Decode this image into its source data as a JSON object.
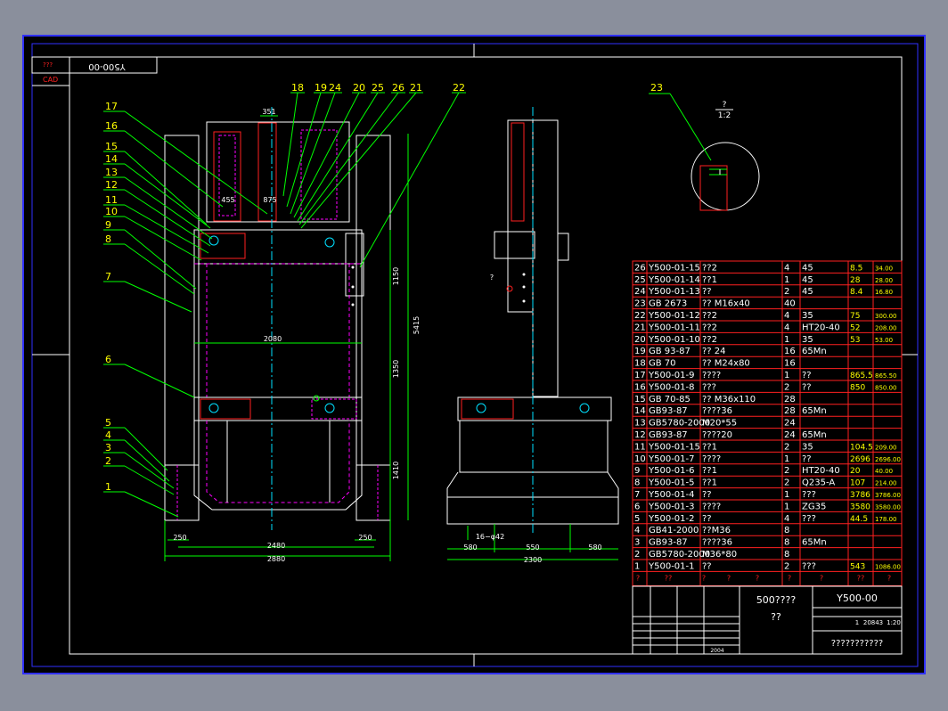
{
  "title_corner": {
    "top": "???",
    "cad": "CAD",
    "drawing_no": "Y500-00"
  },
  "balloons": {
    "left_stack": [
      "17",
      "16",
      "15",
      "14",
      "13",
      "12",
      "11",
      "10",
      "9",
      "8",
      "7",
      "6",
      "5",
      "4",
      "3",
      "2",
      "1"
    ],
    "top_row": [
      "18",
      "19",
      "24",
      "20",
      "25",
      "26",
      "21",
      "22"
    ],
    "detail": "23"
  },
  "dims": {
    "top_width": "351",
    "d455": "455",
    "d875": "875",
    "d2080": "2080",
    "d1150": "1150",
    "d1350": "1350",
    "d1410": "1410",
    "d5415": "5415",
    "d250_left": "250",
    "d250_right": "250",
    "d2480": "2480",
    "d2880": "2880",
    "holes": "16−φ42",
    "d580a": "580",
    "d550": "550",
    "d580b": "580",
    "d2300": "2300",
    "side_q": "?"
  },
  "detail_label": {
    "num": "?",
    "scale": "1:2"
  },
  "bom": [
    {
      "no": "26",
      "code": "Y500-01-15",
      "name": "??2",
      "qty": "4",
      "mat": "45",
      "w1": "8.5",
      "w2": "34.00"
    },
    {
      "no": "25",
      "code": "Y500-01-14",
      "name": "??1",
      "qty": "1",
      "mat": "45",
      "w1": "28",
      "w2": "28.00"
    },
    {
      "no": "24",
      "code": "Y500-01-13",
      "name": "??",
      "qty": "2",
      "mat": "45",
      "w1": "8.4",
      "w2": "16.80"
    },
    {
      "no": "23",
      "code": "GB 2673",
      "name": "??  M16x40",
      "qty": "40",
      "mat": "",
      "w1": "",
      "w2": ""
    },
    {
      "no": "22",
      "code": "Y500-01-12",
      "name": "??2",
      "qty": "4",
      "mat": "35",
      "w1": "75",
      "w2": "300.00"
    },
    {
      "no": "21",
      "code": "Y500-01-11",
      "name": "??2",
      "qty": "4",
      "mat": "HT20-40",
      "w1": "52",
      "w2": "208.00"
    },
    {
      "no": "20",
      "code": "Y500-01-10",
      "name": "??2",
      "qty": "1",
      "mat": "35",
      "w1": "53",
      "w2": "53.00"
    },
    {
      "no": "19",
      "code": "GB 93-87",
      "name": "?? 24",
      "qty": "16",
      "mat": "65Mn",
      "w1": "",
      "w2": ""
    },
    {
      "no": "18",
      "code": "GB 70",
      "name": "?? M24x80",
      "qty": "16",
      "mat": "",
      "w1": "",
      "w2": ""
    },
    {
      "no": "17",
      "code": "Y500-01-9",
      "name": "????",
      "qty": "1",
      "mat": "??",
      "w1": "865.5",
      "w2": "865.50"
    },
    {
      "no": "16",
      "code": "Y500-01-8",
      "name": "???",
      "qty": "2",
      "mat": "??",
      "w1": "850",
      "w2": "850.00"
    },
    {
      "no": "15",
      "code": "GB 70-85",
      "name": "?? M36x110",
      "qty": "28",
      "mat": "",
      "w1": "",
      "w2": ""
    },
    {
      "no": "14",
      "code": "GB93-87",
      "name": "????36",
      "qty": "28",
      "mat": "65Mn",
      "w1": "",
      "w2": ""
    },
    {
      "no": "13",
      "code": "GB5780-2000",
      "name": "M20*55",
      "qty": "24",
      "mat": "",
      "w1": "",
      "w2": ""
    },
    {
      "no": "12",
      "code": "GB93-87",
      "name": "????20",
      "qty": "24",
      "mat": "65Mn",
      "w1": "",
      "w2": ""
    },
    {
      "no": "11",
      "code": "Y500-01-15",
      "name": "??1",
      "qty": "2",
      "mat": "35",
      "w1": "104.5",
      "w2": "209.00"
    },
    {
      "no": "10",
      "code": "Y500-01-7",
      "name": "????",
      "qty": "1",
      "mat": "??",
      "w1": "2696",
      "w2": "2696.00"
    },
    {
      "no": "9",
      "code": "Y500-01-6",
      "name": "??1",
      "qty": "2",
      "mat": "HT20-40",
      "w1": "20",
      "w2": "40.00"
    },
    {
      "no": "8",
      "code": "Y500-01-5",
      "name": "??1",
      "qty": "2",
      "mat": "Q235-A",
      "w1": "107",
      "w2": "214.00"
    },
    {
      "no": "7",
      "code": "Y500-01-4",
      "name": "??",
      "qty": "1",
      "mat": "???",
      "w1": "3786",
      "w2": "3786.00"
    },
    {
      "no": "6",
      "code": "Y500-01-3",
      "name": "????",
      "qty": "1",
      "mat": "ZG35",
      "w1": "3580",
      "w2": "3580.00"
    },
    {
      "no": "5",
      "code": "Y500-01-2",
      "name": "??",
      "qty": "4",
      "mat": "???",
      "w1": "44.5",
      "w2": "178.00"
    },
    {
      "no": "4",
      "code": "GB41-2000",
      "name": "??M36",
      "qty": "8",
      "mat": "",
      "w1": "",
      "w2": ""
    },
    {
      "no": "3",
      "code": "GB93-87",
      "name": "????36",
      "qty": "8",
      "mat": "65Mn",
      "w1": "",
      "w2": ""
    },
    {
      "no": "2",
      "code": "GB5780-2000",
      "name": "M36*80",
      "qty": "8",
      "mat": "",
      "w1": "",
      "w2": ""
    },
    {
      "no": "1",
      "code": "Y500-01-1",
      "name": "??",
      "qty": "2",
      "mat": "???",
      "w1": "543",
      "w2": "1086.00"
    }
  ],
  "bom_header": [
    "?",
    "??",
    "?",
    "?",
    "?",
    "?",
    "?",
    "??",
    "?"
  ],
  "title_block": {
    "product": "500????",
    "subtitle": "??",
    "code": "Y500-00",
    "sheet": "1",
    "weight": "20843",
    "scale": "1:20",
    "company": "???????????",
    "year": "2004"
  },
  "colors": {
    "background": "#000000",
    "outer": "#8a8f9c",
    "frame": "#3030ff",
    "dim": "#00ff00",
    "outline": "#ffffff",
    "hidden": "#ff00ff",
    "leader": "#00ff00",
    "label": "#ffff00",
    "red": "#ff2020",
    "cyan": "#00e0ff"
  }
}
